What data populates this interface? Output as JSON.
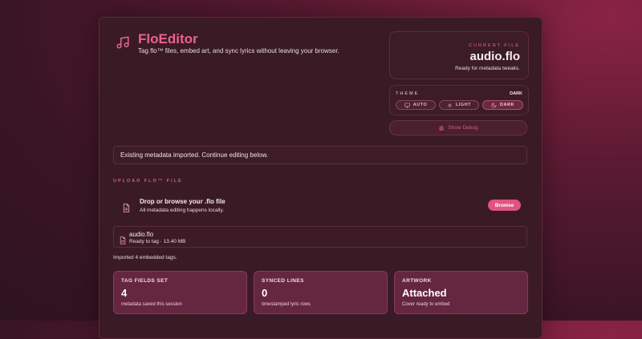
{
  "app": {
    "title": "FloEditor",
    "subtitle": "Tag flo™ files, embed art, and sync lyrics without leaving your browser."
  },
  "current_file": {
    "label": "CURRENT FILE",
    "name": "audio.flo",
    "status": "Ready for metadata tweaks."
  },
  "theme": {
    "label": "THEME",
    "value": "DARK",
    "options": [
      {
        "label": "AUTO",
        "icon": "monitor-icon"
      },
      {
        "label": "LIGHT",
        "icon": "sun-icon"
      },
      {
        "label": "DARK",
        "icon": "moon-icon"
      }
    ]
  },
  "debug_label": "Show Debug",
  "banner": "Existing metadata imported. Continue editing below.",
  "upload": {
    "section_label": "UPLOAD FLO™ FILE",
    "drop_title": "Drop or browse your .flo file",
    "drop_sub": "All metadata editing happens locally.",
    "browse_label": "Browse"
  },
  "file": {
    "name": "audio.flo",
    "meta": "Ready to tag · 13.40 MB"
  },
  "imported_text": "Imported 4 embedded tags.",
  "stats": [
    {
      "heading": "TAG FIELDS SET",
      "value": "4",
      "desc": "metadata saved this session"
    },
    {
      "heading": "SYNCED LINES",
      "value": "0",
      "desc": "timestamped lyric rows"
    },
    {
      "heading": "ARTWORK",
      "value": "Attached",
      "desc": "Cover ready to embed"
    }
  ],
  "colors": {
    "accent": "#e8628f",
    "card": "#3a1b25",
    "stat_bg": "#652640"
  }
}
